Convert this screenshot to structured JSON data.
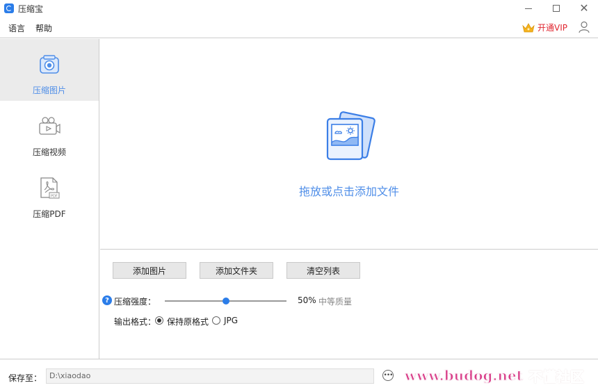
{
  "window": {
    "title": "压缩宝",
    "controls": [
      "minimize-icon",
      "maximize-icon",
      "close-icon"
    ]
  },
  "menu": {
    "language": "语言",
    "help": "帮助",
    "vip": "开通VIP"
  },
  "sidebar": {
    "items": [
      {
        "label": "压缩图片",
        "icon": "camera-icon",
        "active": true
      },
      {
        "label": "压缩视频",
        "icon": "video-camera-icon",
        "active": false
      },
      {
        "label": "压缩PDF",
        "icon": "pdf-file-icon",
        "active": false
      }
    ]
  },
  "dropzone": {
    "text": "拖放或点击添加文件",
    "icon": "image-stack-icon"
  },
  "actions": {
    "add_image": "添加图片",
    "add_folder": "添加文件夹",
    "clear_list": "清空列表"
  },
  "compression": {
    "label": "压缩强度：",
    "value": 50,
    "value_text": "50%",
    "quality": "中等质量"
  },
  "output": {
    "label": "输出格式：",
    "options": [
      {
        "label": "保持原格式",
        "selected": true
      },
      {
        "label": "JPG",
        "selected": false
      }
    ]
  },
  "save": {
    "label": "保存至：",
    "path": "D:\\xiaodao"
  },
  "watermark": {
    "url": "www.budog.net",
    "text": "不懂社区"
  },
  "colors": {
    "accent": "#4f8ee8",
    "primary_blue": "#2b7de9",
    "vip_red": "#e0262f",
    "active_bg": "#ebebeb"
  }
}
